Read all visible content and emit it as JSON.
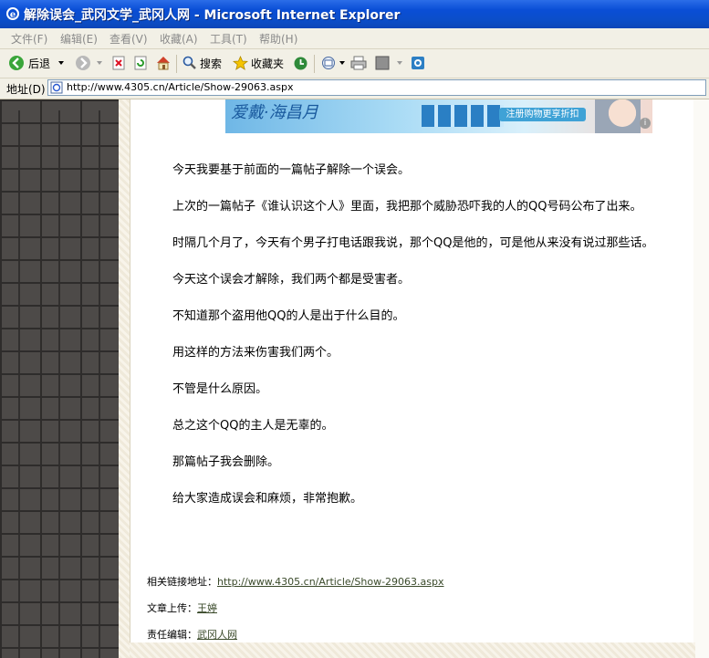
{
  "window": {
    "title": "解除误会_武冈文学_武冈人网 - Microsoft Internet Explorer"
  },
  "menu": [
    "文件(F)",
    "编辑(E)",
    "查看(V)",
    "收藏(A)",
    "工具(T)",
    "帮助(H)"
  ],
  "toolbar": {
    "back_label": "后退",
    "search_label": "搜索",
    "favorites_label": "收藏夹"
  },
  "address": {
    "label": "地址(D)",
    "url": "http://www.4305.cn/Article/Show-29063.aspx"
  },
  "banner": {
    "brand_text": "爱戴·海昌月",
    "button_text": "注册购物更享折扣",
    "info_glyph": "i"
  },
  "article": {
    "paragraphs": [
      "今天我要基于前面的一篇帖子解除一个误会。",
      "上次的一篇帖子《谁认识这个人》里面，我把那个威胁恐吓我的人的QQ号码公布了出来。",
      "时隔几个月了，今天有个男子打电话跟我说，那个QQ是他的，可是他从来没有说过那些话。",
      "今天这个误会才解除，我们两个都是受害者。",
      "不知道那个盗用他QQ的人是出于什么目的。",
      "用这样的方法来伤害我们两个。",
      "不管是什么原因。",
      "总之这个QQ的主人是无辜的。",
      "那篇帖子我会删除。",
      "给大家造成误会和麻烦，非常抱歉。"
    ]
  },
  "meta": {
    "link_label": "相关链接地址：",
    "link_url": "http://www.4305.cn/Article/Show-29063.aspx",
    "uploader_label": "文章上传：",
    "uploader": "王婷",
    "editor_label": "责任编辑：",
    "editor": "武冈人网"
  }
}
